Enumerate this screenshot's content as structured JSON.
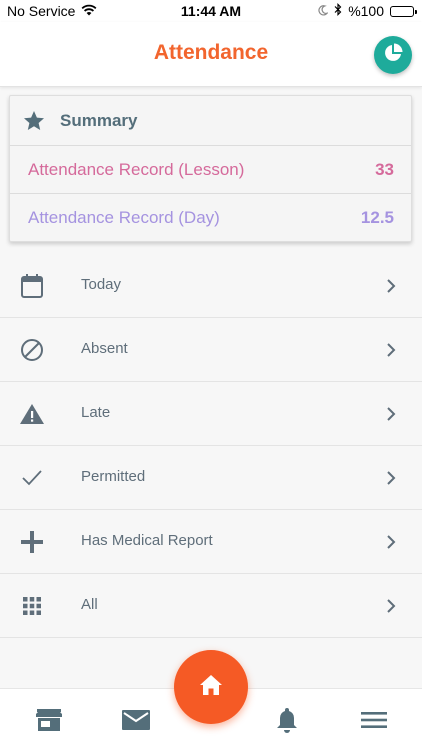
{
  "status_bar": {
    "carrier": "No Service",
    "time": "11:44 AM",
    "battery_text": "%100"
  },
  "header": {
    "title": "Attendance",
    "title_color": "#f2652e",
    "chart_button_icon": "pie-chart-icon"
  },
  "summary": {
    "title": "Summary",
    "icon": "star-icon",
    "rows": [
      {
        "label": "Attendance Record (Lesson)",
        "value": "33",
        "color": "#d56a9b"
      },
      {
        "label": "Attendance Record (Day)",
        "value": "12.5",
        "color": "#a593e0"
      }
    ]
  },
  "menu": {
    "items": [
      {
        "label": "Today",
        "icon": "calendar-icon"
      },
      {
        "label": "Absent",
        "icon": "block-icon"
      },
      {
        "label": "Late",
        "icon": "warning-icon"
      },
      {
        "label": "Permitted",
        "icon": "check-icon"
      },
      {
        "label": "Has Medical Report",
        "icon": "plus-icon"
      },
      {
        "label": "All",
        "icon": "grid-icon"
      }
    ]
  },
  "bottom_nav": {
    "items": [
      "store-icon",
      "mail-icon",
      "home-icon",
      "bell-icon",
      "menu-icon"
    ],
    "accent": "#f55a25"
  }
}
